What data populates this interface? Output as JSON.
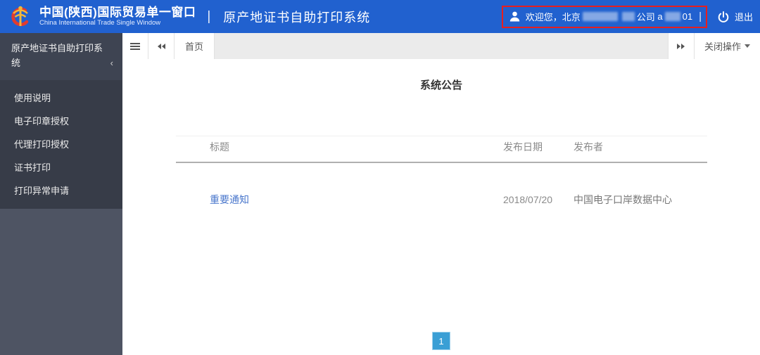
{
  "header": {
    "org_title": "中国(陕西)国际贸易单一窗口",
    "org_subtitle": "China International Trade Single Window",
    "divider": "|",
    "app_title": "原产地证书自助打印系统",
    "welcome_prefix": "欢迎您，北京",
    "welcome_company": "公司",
    "welcome_account_prefix": "a",
    "welcome_account_suffix": "01",
    "box_divider": "|",
    "logout_label": "退出"
  },
  "sidebar": {
    "title": "原产地证书自助打印系统",
    "collapse_icon": "‹",
    "items": [
      {
        "label": "使用说明"
      },
      {
        "label": "电子印章授权"
      },
      {
        "label": "代理打印授权"
      },
      {
        "label": "证书打印"
      },
      {
        "label": "打印异常申请"
      }
    ]
  },
  "tabbar": {
    "active_tab": "首页",
    "close_menu_label": "关闭操作"
  },
  "main": {
    "heading": "系统公告",
    "table": {
      "columns": [
        "标题",
        "发布日期",
        "发布者"
      ],
      "rows": [
        {
          "title": "重要通知",
          "date": "2018/07/20",
          "publisher": "中国电子口岸数据中心"
        }
      ]
    },
    "pagination": {
      "current_page": "1"
    }
  },
  "colors": {
    "header_bg": "#2161cf",
    "sidebar_base": "#4e5463",
    "sidebar_header": "#3e4452",
    "sidebar_submenu": "#373c48",
    "annotation_red": "#e81e1e",
    "link_blue": "#4a77cc",
    "pagination_blue": "#3a9fd5"
  }
}
